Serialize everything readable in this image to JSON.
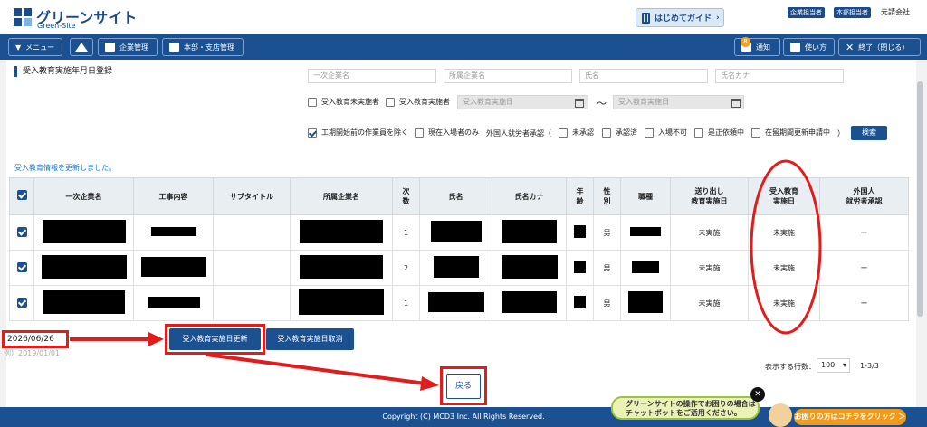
{
  "header": {
    "logo_title": "グリーンサイト",
    "logo_sub": "Green-Site",
    "guide_label": "はじめてガイド",
    "badges": [
      "企業担当者",
      "本部担当者"
    ],
    "company": "元請会社"
  },
  "nav": {
    "menu": "メニュー",
    "company_mgmt": "企業管理",
    "branch_mgmt": "本部・支店管理",
    "notify": "通知",
    "notify_count": "8",
    "howto": "使い方",
    "exit": "終了（閉じる）"
  },
  "page": {
    "title": "受入教育実施年月日登録",
    "message": "受入教育情報を更新しました。"
  },
  "filters": {
    "primary_company_ph": "一次企業名",
    "affiliated_company_ph": "所属企業名",
    "name_ph": "氏名",
    "name_kana_ph": "氏名カナ",
    "not_done": "受入教育未実施者",
    "done": "受入教育実施者",
    "date_from_ph": "受入教育実施日",
    "tilde": "〜",
    "date_to_ph": "受入教育実施日",
    "exclude_before": "工期開始前の作業員を除く",
    "current_only": "現在入場者のみ",
    "foreign_label": "外国人就労者承認（",
    "unapproved": "未承認",
    "approved": "承認済",
    "entry_denied": "入場不可",
    "correction": "是正依頼中",
    "renewal": "在留期間更新申請中",
    "close_paren": "）",
    "search": "検索"
  },
  "table": {
    "headers": {
      "primary": "一次企業名",
      "work": "工事内容",
      "subtitle": "サブタイトル",
      "affiliated": "所属企業名",
      "count": "次数",
      "name": "氏名",
      "kana": "氏名カナ",
      "age": "年齢",
      "sex": "性別",
      "job": "職種",
      "sent_l1": "送り出し",
      "sent_l2": "教育実施日",
      "recv_l1": "受入教育",
      "recv_l2": "実施日",
      "foreign_l1": "外国人",
      "foreign_l2": "就労者承認"
    },
    "rows": [
      {
        "order": "1",
        "sex": "男",
        "sent": "未実施",
        "recv": "未実施",
        "foreign": "ー"
      },
      {
        "order": "2",
        "sex": "男",
        "sent": "未実施",
        "recv": "未実施",
        "foreign": "ー"
      },
      {
        "order": "1",
        "sex": "男",
        "sent": "未実施",
        "recv": "未実施",
        "foreign": "ー"
      }
    ]
  },
  "actions": {
    "date_value": "2026/06/26",
    "date_hint": "例）2019/01/01",
    "update": "受入教育実施日更新",
    "cancel": "受入教育実施日取消",
    "back": "戻る"
  },
  "pager": {
    "rows_label": "表示する行数：",
    "rows_value": "100",
    "range": "1-3/3"
  },
  "footer": {
    "copyright": "Copyright (C) MCD3 Inc. All Rights Reserved."
  },
  "chatbot": {
    "line1": "グリーンサイトの操作でお困りの場合は",
    "line2": "チャットボットをご活用ください。",
    "button": "お困りの方はコチラをクリック ＞"
  },
  "colors": {
    "brand": "#1b5191",
    "annotation": "#e21b1b",
    "message": "#1b75c8"
  }
}
